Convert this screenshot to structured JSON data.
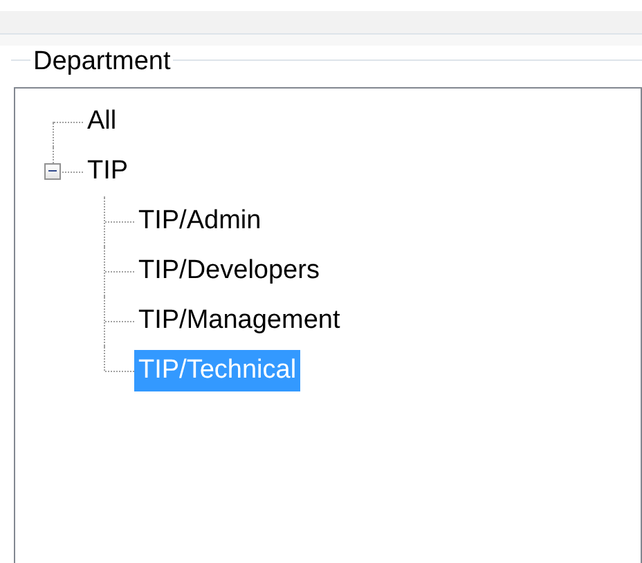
{
  "group": {
    "title": "Department"
  },
  "tree": [
    {
      "label": "All",
      "selected": false
    },
    {
      "label": "TIP",
      "selected": false,
      "expanded": true,
      "children": [
        {
          "label": "TIP/Admin",
          "selected": false
        },
        {
          "label": "TIP/Developers",
          "selected": false
        },
        {
          "label": "TIP/Management",
          "selected": false
        },
        {
          "label": "TIP/Technical",
          "selected": true
        }
      ]
    }
  ]
}
